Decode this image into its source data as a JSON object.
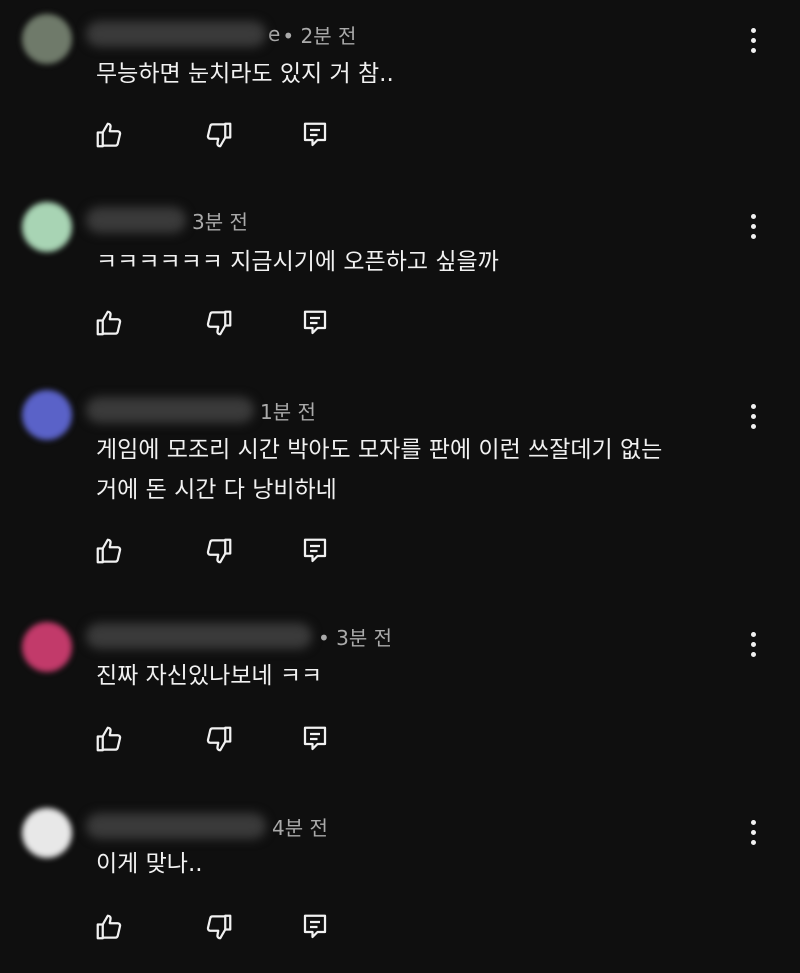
{
  "comments": [
    {
      "author": "",
      "author_visible_fragment": "e",
      "time": "• 2분 전",
      "text": "무능하면 눈치라도 있지 거 참..",
      "avatar_color": "#6f7a6a"
    },
    {
      "author": "",
      "time": "3분 전",
      "text": "ㅋㅋㅋㅋㅋㅋ 지금시기에 오픈하고 싶을까",
      "avatar_color": "#a8d4b4"
    },
    {
      "author": "",
      "time": "1분 전",
      "text": "게임에 모조리 시간 박아도 모자를 판에 이런 쓰잘데기 없는거에 돈 시간 다 낭비하네",
      "avatar_color": "#5a62c8"
    },
    {
      "author": "",
      "time": "• 3분 전",
      "text": "진짜 자신있나보네 ㅋㅋ",
      "avatar_color": "#c23a6a"
    },
    {
      "author": "",
      "time": "4분 전",
      "text": "이게 맞나..",
      "avatar_color": "#e8e8e8"
    }
  ],
  "icons": {
    "like": "thumbs-up-icon",
    "dislike": "thumbs-down-icon",
    "reply": "reply-icon",
    "menu": "more-vert-icon"
  },
  "colors": {
    "background": "#0f0f0f",
    "text": "#f1f1f1",
    "secondary_text": "#aaaaaa"
  }
}
